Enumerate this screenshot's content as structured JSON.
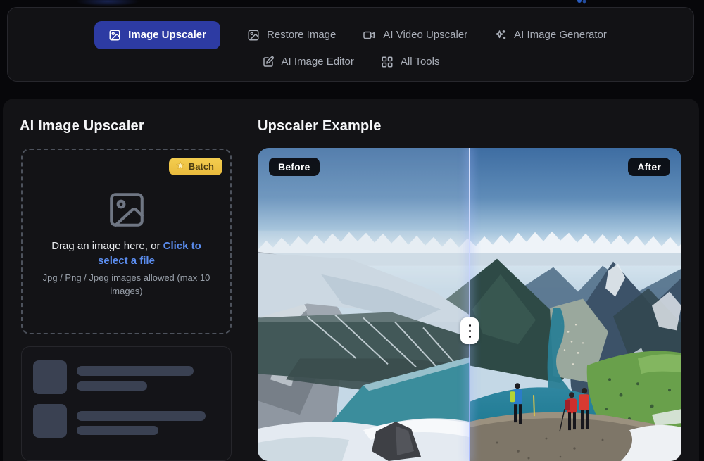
{
  "colors": {
    "page-bg": "#07070a",
    "nav-bg": "#121215",
    "panel-bg": "#131316",
    "accent": "#2d3ba3",
    "link": "#5b8def",
    "batch-from": "#f4ce50",
    "batch-to": "#e9ba3c",
    "skeleton": "#3a4152"
  },
  "nav": {
    "row1": [
      {
        "label": "Image Upscaler",
        "icon": "image-icon",
        "active": true
      },
      {
        "label": "Restore Image",
        "icon": "restore-image-icon",
        "active": false
      },
      {
        "label": "AI Video Upscaler",
        "icon": "video-icon",
        "active": false
      },
      {
        "label": "AI Image Generator",
        "icon": "sparkles-icon",
        "active": false
      }
    ],
    "row2": [
      {
        "label": "AI Image Editor",
        "icon": "edit-icon",
        "active": false
      },
      {
        "label": "All Tools",
        "icon": "grid-icon",
        "active": false
      }
    ]
  },
  "uploader": {
    "title": "AI Image Upscaler",
    "batch_label": "Batch",
    "drag_prefix": "Drag an image here, or ",
    "drag_link": "Click to select a file",
    "formats_text": "Jpg / Png / Jpeg images allowed (max 10 images)"
  },
  "example": {
    "title": "Upscaler Example",
    "before_label": "Before",
    "after_label": "After"
  }
}
